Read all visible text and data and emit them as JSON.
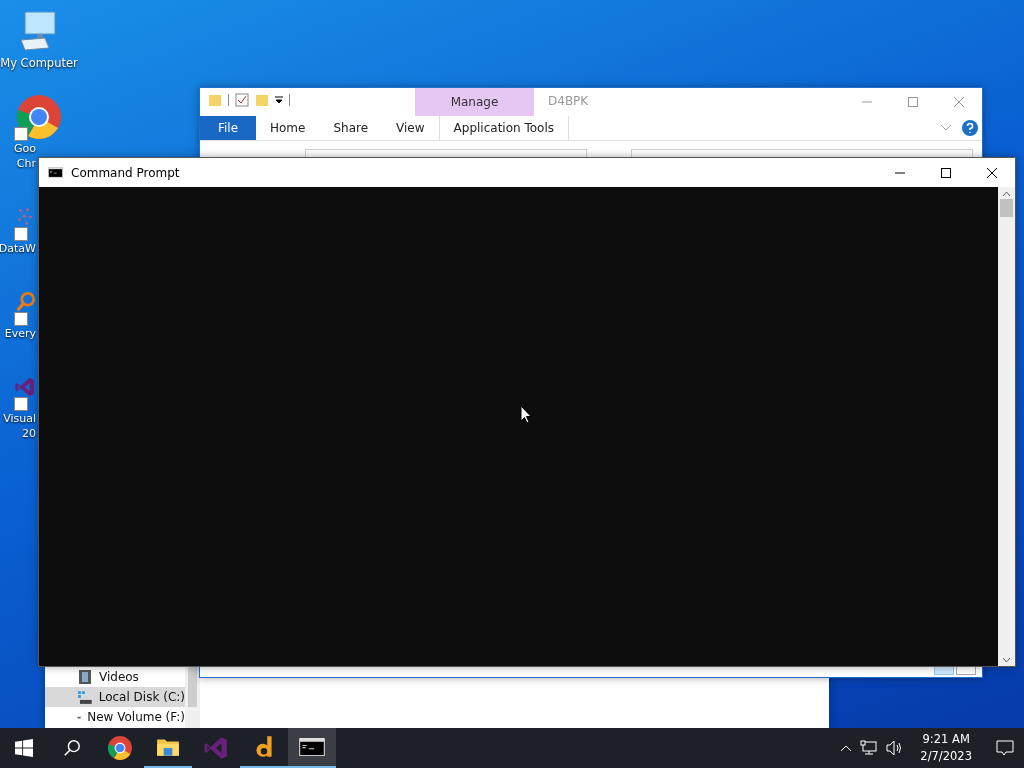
{
  "desktop_icons": [
    {
      "kind": "computer",
      "label_lines": [
        "My Computer"
      ]
    },
    {
      "kind": "chrome",
      "label_lines": [
        "Goo",
        "Chr"
      ]
    },
    {
      "kind": "dots",
      "label_lines": [
        "DataW"
      ]
    },
    {
      "kind": "magnifier",
      "label_lines": [
        "Every"
      ]
    },
    {
      "kind": "studio",
      "label_lines": [
        "Visual",
        "20"
      ]
    }
  ],
  "back_window": {
    "nav_items": [
      {
        "kind": "videos",
        "label": "Videos",
        "selected": false
      },
      {
        "kind": "disk",
        "label": "Local Disk (C:)",
        "selected": true
      },
      {
        "kind": "drive",
        "label": "New Volume (F:)",
        "selected": false
      }
    ]
  },
  "explorer_window": {
    "title": "D4BPK",
    "context_tab": "Manage",
    "ribbon_tabs": [
      {
        "kind": "file",
        "label": "File"
      },
      {
        "kind": "tab",
        "label": "Home"
      },
      {
        "kind": "tab",
        "label": "Share"
      },
      {
        "kind": "tab",
        "label": "View"
      },
      {
        "kind": "context",
        "label": "Application Tools"
      }
    ]
  },
  "cmd_window": {
    "title": "Command Prompt"
  },
  "taskbar": {
    "apps": [
      {
        "kind": "start",
        "running": false,
        "active": false
      },
      {
        "kind": "search",
        "running": false,
        "active": false
      },
      {
        "kind": "chrome",
        "running": false,
        "active": false
      },
      {
        "kind": "folder",
        "running": true,
        "active": false
      },
      {
        "kind": "studio",
        "running": false,
        "active": false
      },
      {
        "kind": "dict",
        "running": true,
        "active": false
      },
      {
        "kind": "cmd",
        "running": true,
        "active": true
      }
    ],
    "clock": {
      "time": "9:21 AM",
      "date": "2/7/2023"
    }
  }
}
